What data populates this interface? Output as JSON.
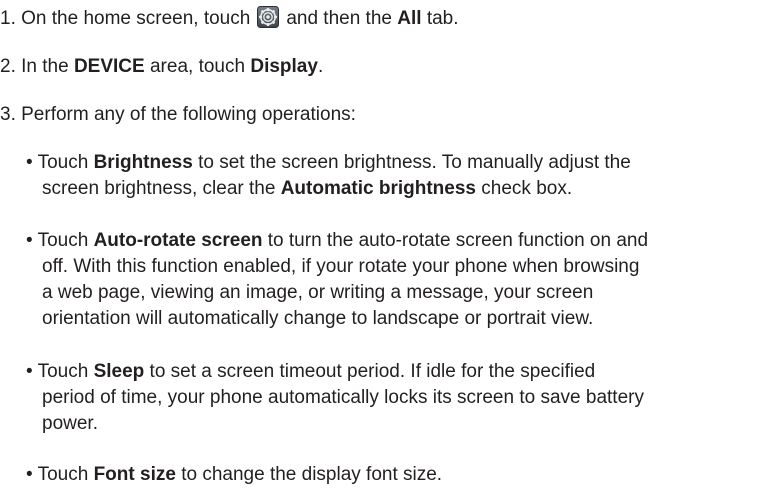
{
  "step1": {
    "prefix": "1. On the home screen, touch",
    "settings_icon": "settings-gear-icon",
    "middle": "and then the",
    "tab_name": "All",
    "suffix": "tab."
  },
  "step2": {
    "prefix": "2. In the",
    "area": "DEVICE",
    "middle": "area, touch",
    "item": "Display",
    "suffix": "."
  },
  "step3": {
    "text": "3. Perform any of the following operations:"
  },
  "bullets": [
    {
      "lines": [
        {
          "t1": "• Touch ",
          "b": "Brightness",
          "t2": " to set the screen brightness. To manually adjust the"
        },
        {
          "t1": "screen brightness, clear the ",
          "b": "Automatic brightness",
          "t2": " check box."
        }
      ]
    },
    {
      "lines": [
        {
          "t1": "• Touch ",
          "b": "Auto-rotate screen",
          "t2": " to turn the auto-rotate screen function on and"
        },
        {
          "t1": "off. With this function enabled, if your rotate your phone when browsing"
        },
        {
          "t1": "a web page, viewing an image, or writing a message, your screen"
        },
        {
          "t1": "orientation will automatically change to landscape or portrait view."
        }
      ]
    },
    {
      "lines": [
        {
          "t1": "• Touch ",
          "b": "Sleep",
          "t2": " to set a screen timeout period. If idle for the specified"
        },
        {
          "t1": "period of time, your phone automatically locks its screen to save battery"
        },
        {
          "t1": "power."
        }
      ]
    },
    {
      "lines": [
        {
          "t1": "• Touch ",
          "b": "Font size",
          "t2": " to change the display font size."
        }
      ]
    }
  ]
}
